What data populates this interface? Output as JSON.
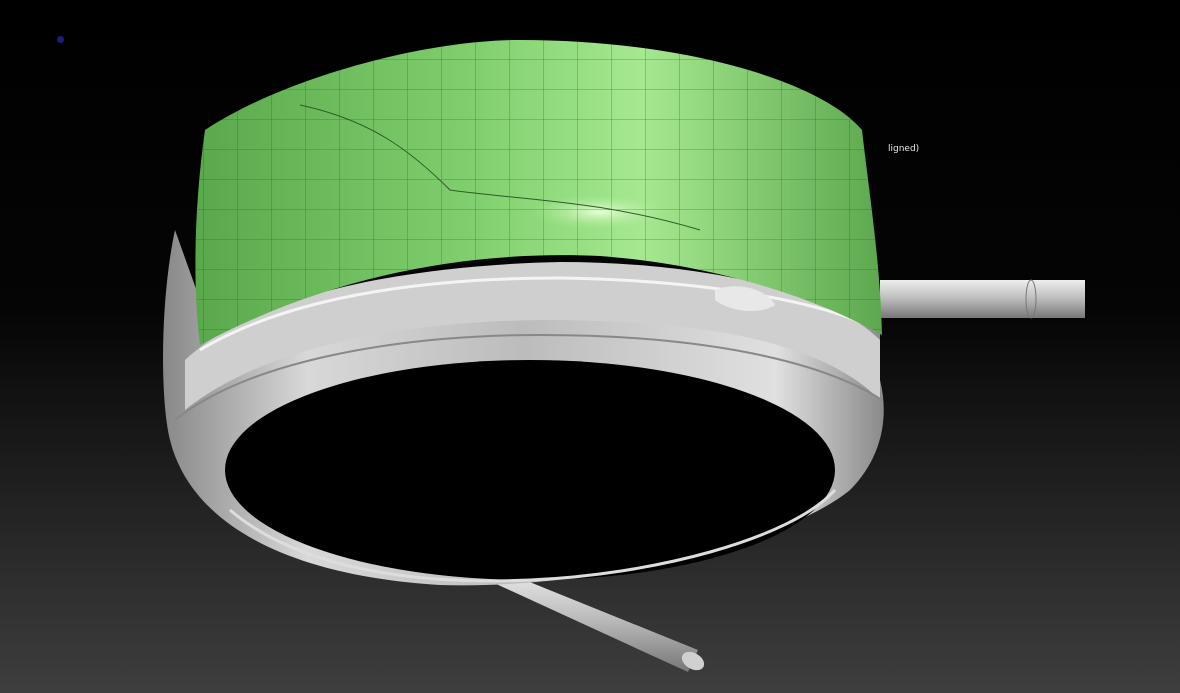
{
  "viewport": {
    "status_text": "ligned)",
    "colors": {
      "mesh_green": "#7fcf6e",
      "mesh_highlight": "#c8f5b0",
      "metal_gray": "#b8b8b8",
      "pivot_blue": "#1d1d80"
    }
  }
}
